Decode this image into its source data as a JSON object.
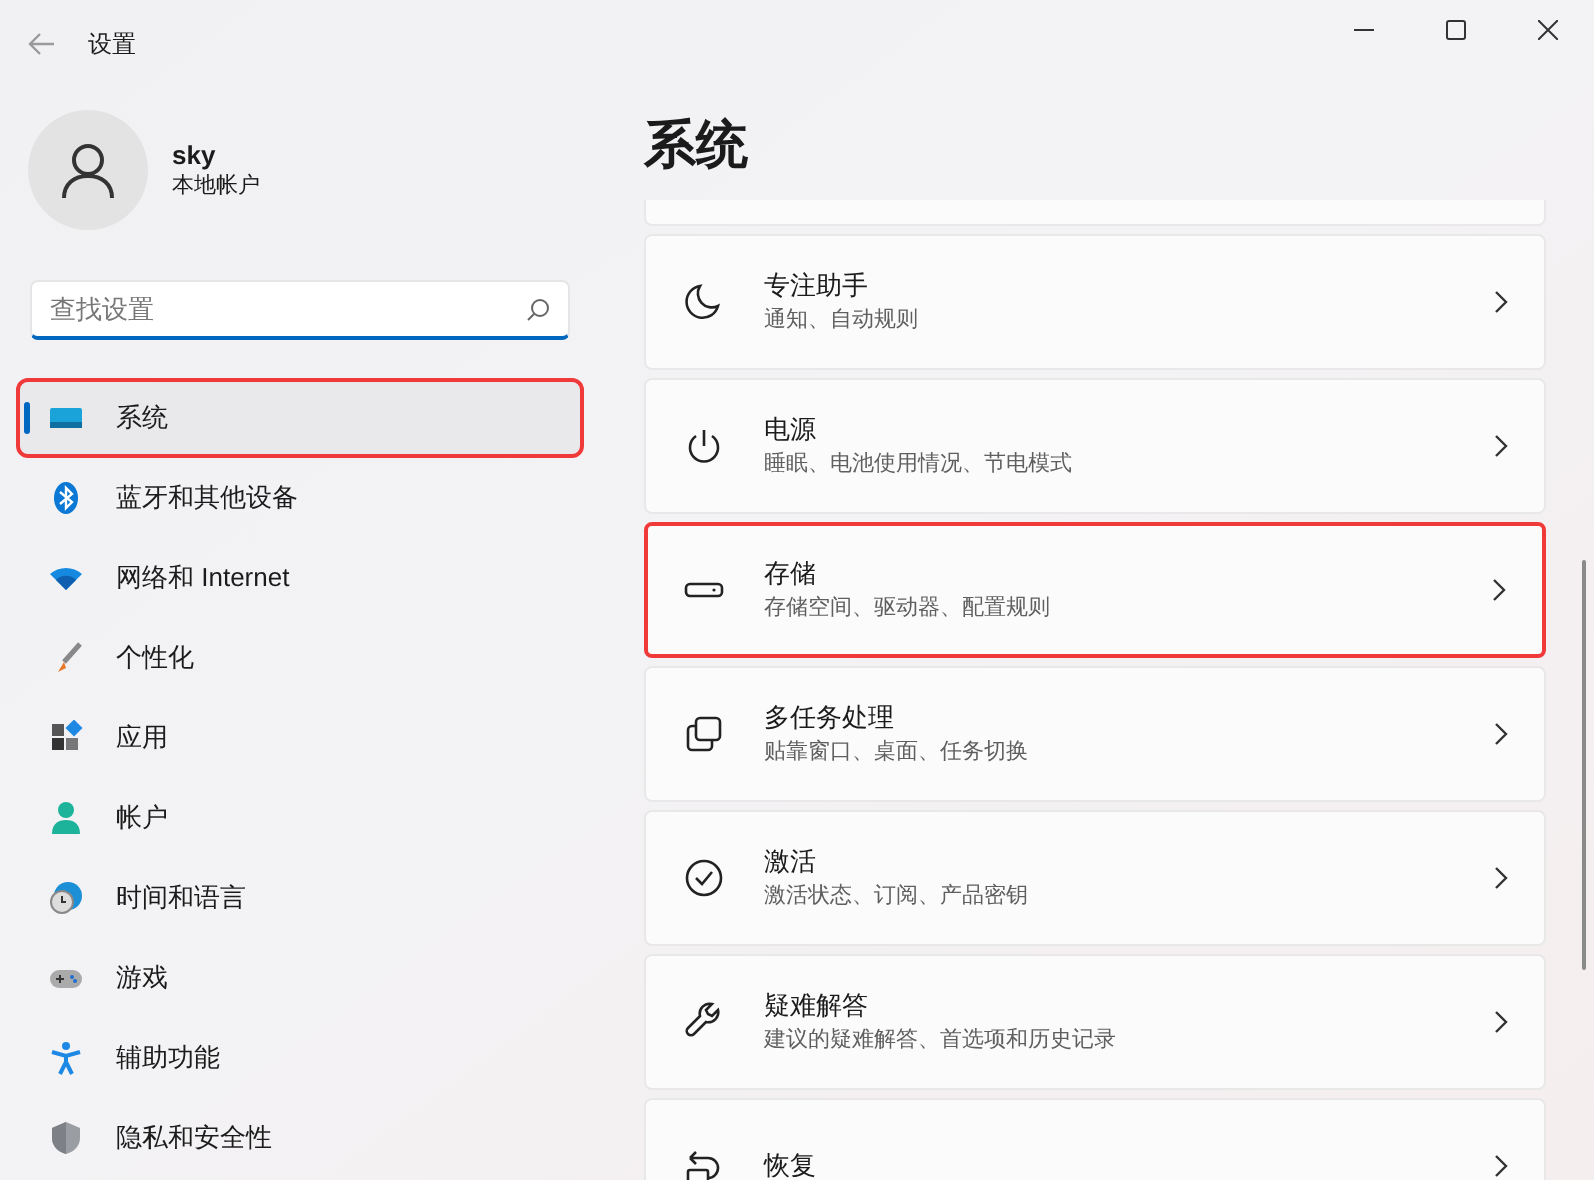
{
  "window": {
    "title": "设置"
  },
  "account": {
    "name": "sky",
    "type": "本地帐户"
  },
  "search": {
    "placeholder": "查找设置"
  },
  "nav": [
    {
      "label": "系统",
      "kind": "system",
      "selected": true,
      "highlighted": true
    },
    {
      "label": "蓝牙和其他设备",
      "kind": "bluetooth",
      "selected": false,
      "highlighted": false
    },
    {
      "label": "网络和 Internet",
      "kind": "wifi",
      "selected": false,
      "highlighted": false
    },
    {
      "label": "个性化",
      "kind": "brush",
      "selected": false,
      "highlighted": false
    },
    {
      "label": "应用",
      "kind": "apps",
      "selected": false,
      "highlighted": false
    },
    {
      "label": "帐户",
      "kind": "person",
      "selected": false,
      "highlighted": false
    },
    {
      "label": "时间和语言",
      "kind": "clock",
      "selected": false,
      "highlighted": false
    },
    {
      "label": "游戏",
      "kind": "gamepad",
      "selected": false,
      "highlighted": false
    },
    {
      "label": "辅助功能",
      "kind": "accessibility",
      "selected": false,
      "highlighted": false
    },
    {
      "label": "隐私和安全性",
      "kind": "shield",
      "selected": false,
      "highlighted": false
    }
  ],
  "page": {
    "title": "系统"
  },
  "cards": [
    {
      "title": "专注助手",
      "subtitle": "通知、自动规则",
      "kind": "moon",
      "highlighted": false
    },
    {
      "title": "电源",
      "subtitle": "睡眠、电池使用情况、节电模式",
      "kind": "power",
      "highlighted": false
    },
    {
      "title": "存储",
      "subtitle": "存储空间、驱动器、配置规则",
      "kind": "drive",
      "highlighted": true
    },
    {
      "title": "多任务处理",
      "subtitle": "贴靠窗口、桌面、任务切换",
      "kind": "windows",
      "highlighted": false
    },
    {
      "title": "激活",
      "subtitle": "激活状态、订阅、产品密钥",
      "kind": "check",
      "highlighted": false
    },
    {
      "title": "疑难解答",
      "subtitle": "建议的疑难解答、首选项和历史记录",
      "kind": "wrench",
      "highlighted": false
    },
    {
      "title": "恢复",
      "kind": "recovery",
      "highlighted": false
    }
  ]
}
